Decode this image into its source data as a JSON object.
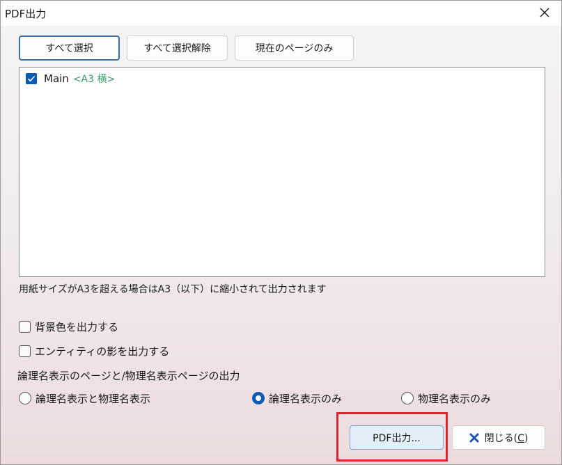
{
  "window": {
    "title": "PDF出力",
    "close_icon": "close-icon"
  },
  "toolbar": {
    "select_all": "すべて選択",
    "deselect_all": "すべて選択解除",
    "current_page_only": "現在のページのみ"
  },
  "page_list": {
    "items": [
      {
        "name": "Main",
        "size": "<A3 横>",
        "checked": true
      }
    ]
  },
  "note": "用紙サイズがA3を超える場合はA3（以下）に縮小されて出力されます",
  "options": {
    "background_color": {
      "label": "背景色を出力する",
      "checked": false
    },
    "entity_shadow": {
      "label": "エンティティの影を出力する",
      "checked": false
    }
  },
  "name_display": {
    "section_label": "論理名表示のページと/物理名表示ページの出力",
    "choices": [
      {
        "label": "論理名表示と物理名表示",
        "selected": false
      },
      {
        "label": "論理名表示のみ",
        "selected": true
      },
      {
        "label": "物理名表示のみ",
        "selected": false
      }
    ]
  },
  "footer": {
    "pdf_output": "PDF出力...",
    "close_prefix": "閉じる(",
    "close_mnemonic": "C",
    "close_suffix": ")"
  },
  "colors": {
    "accent": "#0a5bb5",
    "highlight": "#e0242e",
    "paper_size_text": "#3a9a6a"
  }
}
